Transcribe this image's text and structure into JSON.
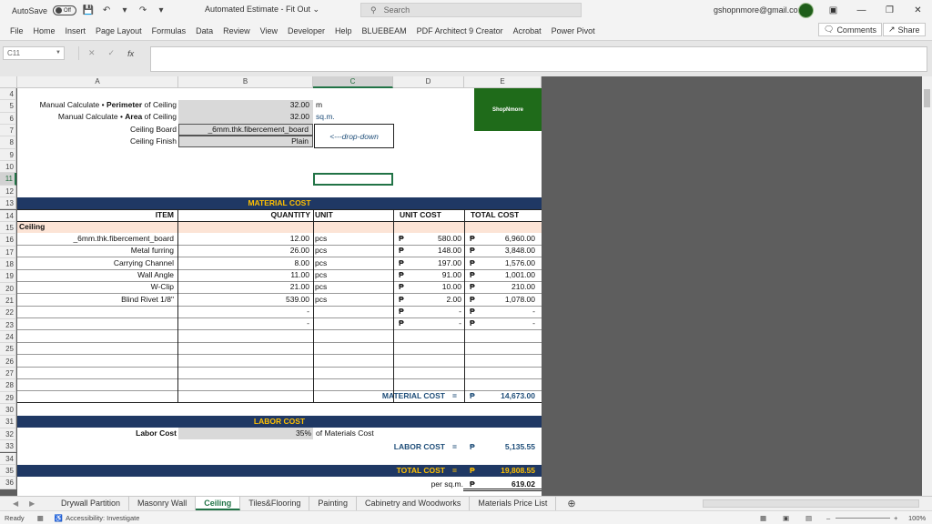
{
  "titlebar": {
    "autosave_label": "AutoSave",
    "autosave_state": "Off",
    "doc_title": "Automated Estimate - Fit Out",
    "search_placeholder": "Search",
    "account": "gshopnmore@gmail.com"
  },
  "ribbon": {
    "tabs": [
      "File",
      "Home",
      "Insert",
      "Page Layout",
      "Formulas",
      "Data",
      "Review",
      "View",
      "Developer",
      "Help",
      "BLUEBEAM",
      "PDF Architect 9 Creator",
      "Acrobat",
      "Power Pivot"
    ],
    "comments_label": "Comments",
    "share_label": "Share"
  },
  "formula_bar": {
    "namebox": "C11",
    "fx": "fx"
  },
  "columns": [
    "A",
    "B",
    "C",
    "D",
    "E"
  ],
  "rows": [
    "4",
    "5",
    "6",
    "7",
    "8",
    "9",
    "10",
    "11",
    "12",
    "13",
    "14",
    "15",
    "16",
    "17",
    "18",
    "19",
    "20",
    "21",
    "22",
    "23",
    "24",
    "25",
    "26",
    "27",
    "28",
    "29",
    "30",
    "31",
    "32",
    "33",
    "34",
    "35",
    "36"
  ],
  "sheet": {
    "perimeter_label_pre": "Manual Calculate • ",
    "perimeter_label_bold": "Perimeter",
    "perimeter_label_post": " of Ceiling",
    "perimeter_value": "32.00",
    "perimeter_unit": "m",
    "area_label_pre": "Manual Calculate • ",
    "area_label_bold": "Area",
    "area_label_post": " of Ceiling",
    "area_value": "32.00",
    "area_unit": "sq.m.",
    "board_label": "Ceiling Board",
    "board_value": "_6mm.thk.fibercement_board",
    "finish_label": "Ceiling Finish",
    "finish_value": "Plain",
    "dropdown_hint": "<---drop-down",
    "logo_text": "ShopNmore",
    "material_cost_header": "MATERIAL COST",
    "table_headers": {
      "item": "ITEM",
      "quantity": "QUANTITY",
      "unit": "UNIT",
      "unit_cost": "UNIT COST",
      "total_cost": "TOTAL COST"
    },
    "section_label": "Ceiling",
    "peso": "₱",
    "items": [
      {
        "item": "_6mm.thk.fibercement_board",
        "qty": "12.00",
        "unit": "pcs",
        "unit_cost": "580.00",
        "total": "6,960.00"
      },
      {
        "item": "Metal furring",
        "qty": "26.00",
        "unit": "pcs",
        "unit_cost": "148.00",
        "total": "3,848.00"
      },
      {
        "item": "Carrying Channel",
        "qty": "8.00",
        "unit": "pcs",
        "unit_cost": "197.00",
        "total": "1,576.00"
      },
      {
        "item": "Wall Angle",
        "qty": "11.00",
        "unit": "pcs",
        "unit_cost": "91.00",
        "total": "1,001.00"
      },
      {
        "item": "W-Clip",
        "qty": "21.00",
        "unit": "pcs",
        "unit_cost": "10.00",
        "total": "210.00"
      },
      {
        "item": "Blind Rivet 1/8\"",
        "qty": "539.00",
        "unit": "pcs",
        "unit_cost": "2.00",
        "total": "1,078.00"
      },
      {
        "item": "",
        "qty": "-",
        "unit": "",
        "unit_cost": "-",
        "total": "-"
      },
      {
        "item": "",
        "qty": "-",
        "unit": "",
        "unit_cost": "-",
        "total": "-"
      }
    ],
    "material_cost_label": "MATERIAL COST",
    "equals": "=",
    "material_cost_total": "14,673.00",
    "labor_cost_header": "LABOR COST",
    "labor_cost_label": "Labor Cost",
    "labor_pct": "35%",
    "labor_pct_suffix": "of Materials Cost",
    "labor_cost_total_label": "LABOR COST",
    "labor_cost_total": "5,135.55",
    "total_cost_label": "TOTAL COST",
    "total_cost": "19,808.55",
    "per_sqm_label": "per sq.m.",
    "per_sqm": "619.02"
  },
  "sheet_tabs": [
    "Drywall Partition",
    "Masonry Wall",
    "Ceiling",
    "Tiles&Flooring",
    "Painting",
    "Cabinetry and Woodworks",
    "Materials Price List"
  ],
  "active_tab": "Ceiling",
  "status": {
    "ready": "Ready",
    "accessibility": "Accessibility: Investigate",
    "zoom": "100%"
  }
}
